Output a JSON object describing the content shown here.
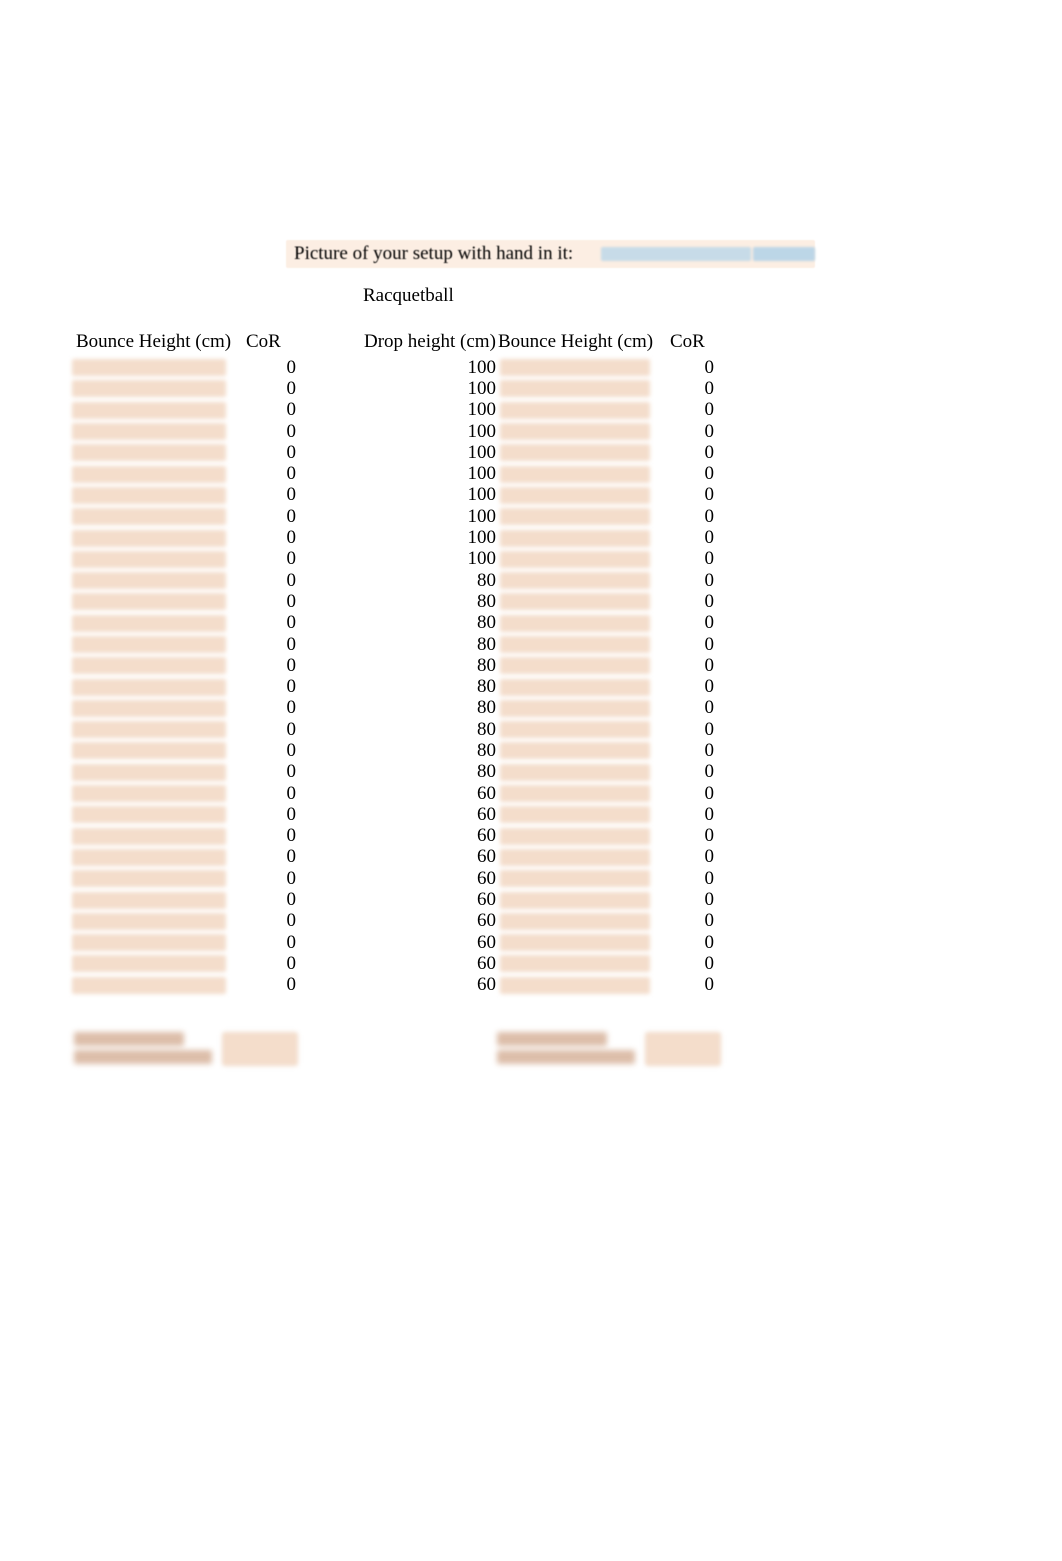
{
  "picture_prompt": "Picture of your setup with hand in it:",
  "title": "Racquetball",
  "headers": {
    "bounce1": "Bounce Height (cm)",
    "cor1": "CoR",
    "drop": "Drop height (cm)",
    "bounce2": "Bounce Height (cm)",
    "cor2": "CoR"
  },
  "rows": [
    {
      "cor1": "0",
      "drop": "100",
      "cor2": "0"
    },
    {
      "cor1": "0",
      "drop": "100",
      "cor2": "0"
    },
    {
      "cor1": "0",
      "drop": "100",
      "cor2": "0"
    },
    {
      "cor1": "0",
      "drop": "100",
      "cor2": "0"
    },
    {
      "cor1": "0",
      "drop": "100",
      "cor2": "0"
    },
    {
      "cor1": "0",
      "drop": "100",
      "cor2": "0"
    },
    {
      "cor1": "0",
      "drop": "100",
      "cor2": "0"
    },
    {
      "cor1": "0",
      "drop": "100",
      "cor2": "0"
    },
    {
      "cor1": "0",
      "drop": "100",
      "cor2": "0"
    },
    {
      "cor1": "0",
      "drop": "100",
      "cor2": "0"
    },
    {
      "cor1": "0",
      "drop": "80",
      "cor2": "0"
    },
    {
      "cor1": "0",
      "drop": "80",
      "cor2": "0"
    },
    {
      "cor1": "0",
      "drop": "80",
      "cor2": "0"
    },
    {
      "cor1": "0",
      "drop": "80",
      "cor2": "0"
    },
    {
      "cor1": "0",
      "drop": "80",
      "cor2": "0"
    },
    {
      "cor1": "0",
      "drop": "80",
      "cor2": "0"
    },
    {
      "cor1": "0",
      "drop": "80",
      "cor2": "0"
    },
    {
      "cor1": "0",
      "drop": "80",
      "cor2": "0"
    },
    {
      "cor1": "0",
      "drop": "80",
      "cor2": "0"
    },
    {
      "cor1": "0",
      "drop": "80",
      "cor2": "0"
    },
    {
      "cor1": "0",
      "drop": "60",
      "cor2": "0"
    },
    {
      "cor1": "0",
      "drop": "60",
      "cor2": "0"
    },
    {
      "cor1": "0",
      "drop": "60",
      "cor2": "0"
    },
    {
      "cor1": "0",
      "drop": "60",
      "cor2": "0"
    },
    {
      "cor1": "0",
      "drop": "60",
      "cor2": "0"
    },
    {
      "cor1": "0",
      "drop": "60",
      "cor2": "0"
    },
    {
      "cor1": "0",
      "drop": "60",
      "cor2": "0"
    },
    {
      "cor1": "0",
      "drop": "60",
      "cor2": "0"
    },
    {
      "cor1": "0",
      "drop": "60",
      "cor2": "0"
    },
    {
      "cor1": "0",
      "drop": "60",
      "cor2": "0"
    }
  ]
}
